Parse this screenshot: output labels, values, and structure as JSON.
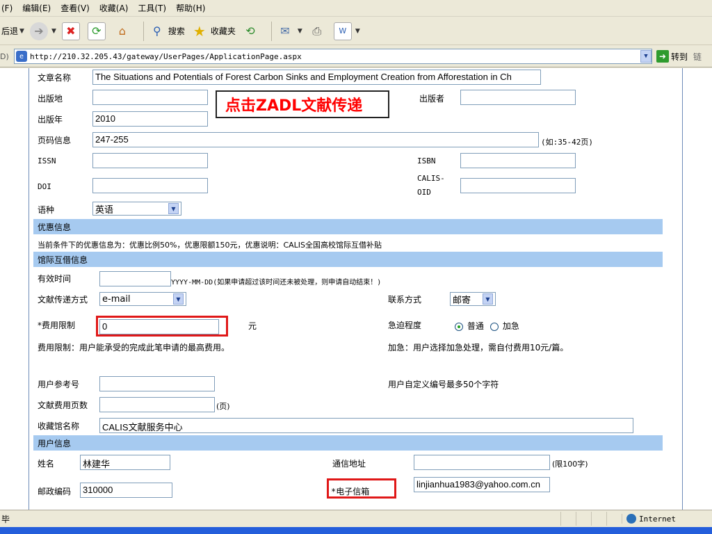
{
  "browser": {
    "menu": [
      "(F)",
      "编辑(E)",
      "查看(V)",
      "收藏(A)",
      "工具(T)",
      "帮助(H)"
    ],
    "toolbar": {
      "back": "后退",
      "search": "搜索",
      "favorites": "收藏夹"
    },
    "address_label": "D)",
    "url": "http://210.32.205.43/gateway/UserPages/ApplicationPage.aspx",
    "go": "转到",
    "links": "链",
    "status_text": "毕",
    "zone": "Internet"
  },
  "callout": "点击ZADL文献传递",
  "form": {
    "title_label": "文章名称",
    "title_value": "The Situations and Potentials of Forest Carbon Sinks and Employment Creation from Afforestation in Ch",
    "place_label": "出版地",
    "publisher_label": "出版者",
    "year_label": "出版年",
    "year_value": "2010",
    "pages_label": "页码信息",
    "pages_value": "247-255",
    "pages_hint": "(如:35-42页)",
    "issn_label": "ISSN",
    "isbn_label": "ISBN",
    "doi_label": "DOI",
    "calis_label_1": "CALIS-",
    "calis_label_2": "OID",
    "lang_label": "语种",
    "lang_value": "英语"
  },
  "discount": {
    "header": "优惠信息",
    "text": "当前条件下的优惠信息为：优惠比例50%，优惠限额150元，优惠说明：CALIS全国高校馆际互借补贴"
  },
  "ill": {
    "header": "馆际互借信息",
    "valid_label": "有效时间",
    "valid_hint": "YYYY-MM-DD(如果申请超过该时间还未被处理，则申请自动结束！)",
    "delivery_label": "文献传递方式",
    "delivery_value": "e-mail",
    "contact_label": "联系方式",
    "contact_value": "邮寄",
    "fee_label": "*费用限制",
    "fee_value": "0",
    "fee_unit": "元",
    "urgency_label": "急迫程度",
    "urgency_normal": "普通",
    "urgency_urgent": "加急",
    "fee_note": "费用限制：用户能承受的完成此笔申请的最高费用。",
    "urgent_note": "加急：用户选择加急处理，需自付费用10元/篇。",
    "ref_label": "用户参考号",
    "ref_note": "用户自定义编号最多50个字符",
    "doc_pages_label": "文献费用页数",
    "doc_pages_unit": "(页)",
    "library_label": "收藏馆名称",
    "library_value": "CALIS文献服务中心"
  },
  "user": {
    "header": "用户信息",
    "name_label": "姓名",
    "name_value": "林建华",
    "address_label": "通信地址",
    "address_hint": "(限100字)",
    "zip_label": "邮政编码",
    "zip_value": "310000",
    "email_label": "*电子信箱",
    "email_value": "linjianhua1983@yahoo.com.cn"
  }
}
